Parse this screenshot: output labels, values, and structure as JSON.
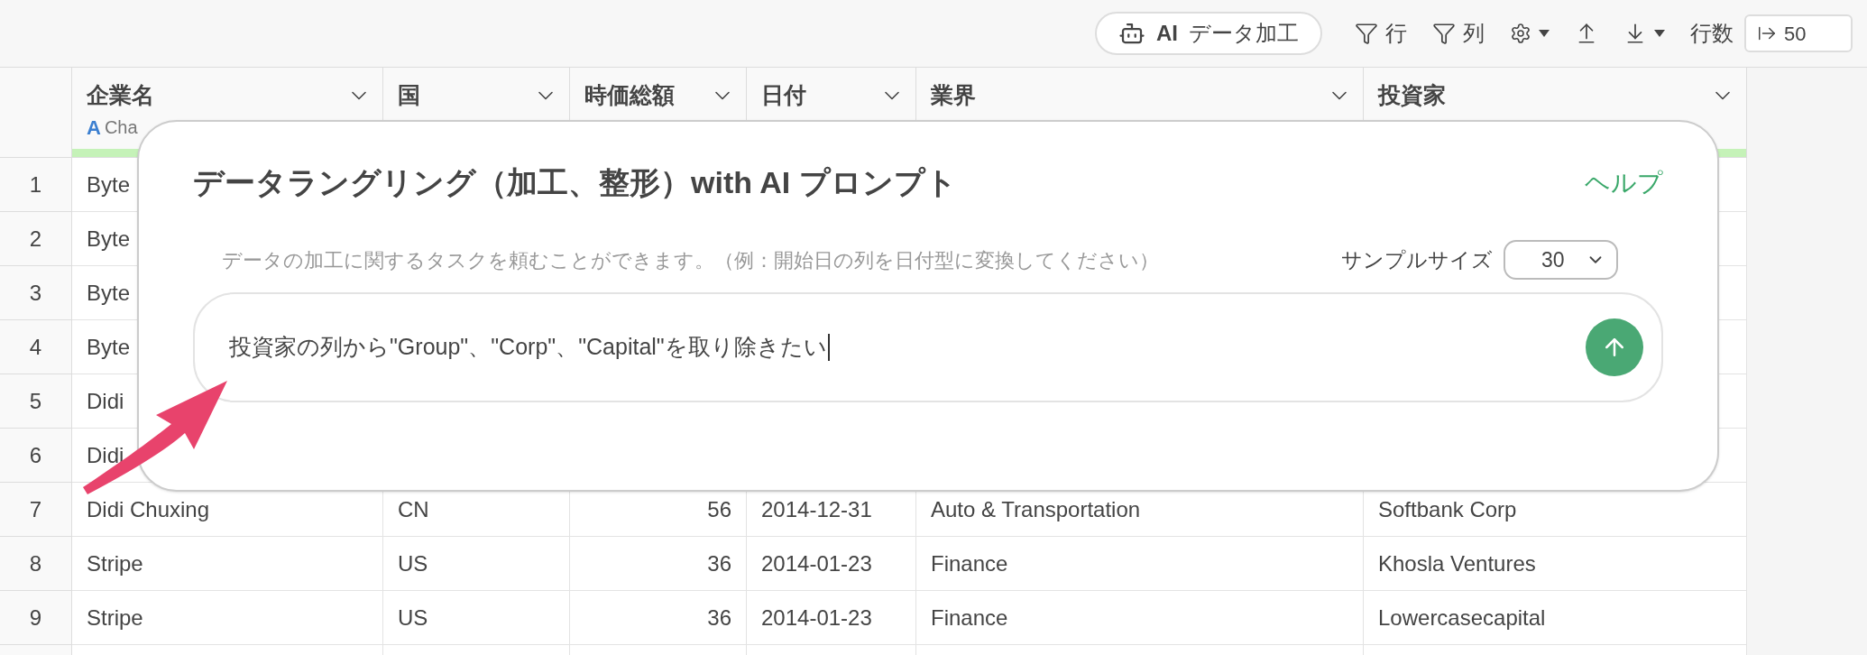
{
  "toolbar": {
    "ai_button": "AI データ加工",
    "row_filter": "行",
    "column_filter": "列",
    "row_count_label": "行数",
    "row_count_value": "50"
  },
  "table": {
    "columns": [
      {
        "label": "企業名",
        "type_icon": "A",
        "type_label": "Cha",
        "kind": "text",
        "highlighted": true
      },
      {
        "label": "国",
        "kind": "text"
      },
      {
        "label": "時価総額",
        "kind": "number"
      },
      {
        "label": "日付",
        "kind": "text"
      },
      {
        "label": "業界",
        "kind": "text"
      },
      {
        "label": "投資家",
        "kind": "text",
        "highlighted": true
      }
    ],
    "rows": [
      {
        "number": "1",
        "cells": [
          "Byte"
        ]
      },
      {
        "number": "2",
        "cells": [
          "Byte"
        ]
      },
      {
        "number": "3",
        "cells": [
          "Byte"
        ]
      },
      {
        "number": "4",
        "cells": [
          "Byte"
        ]
      },
      {
        "number": "5",
        "cells": [
          "Didi"
        ]
      },
      {
        "number": "6",
        "cells": [
          "Didi"
        ]
      },
      {
        "number": "7",
        "cells": [
          "Didi Chuxing",
          "CN",
          "56",
          "2014-12-31",
          "Auto & Transportation",
          "Softbank Corp"
        ]
      },
      {
        "number": "8",
        "cells": [
          "Stripe",
          "US",
          "36",
          "2014-01-23",
          "Finance",
          "Khosla Ventures"
        ]
      },
      {
        "number": "9",
        "cells": [
          "Stripe",
          "US",
          "36",
          "2014-01-23",
          "Finance",
          "Lowercasecapital"
        ]
      }
    ]
  },
  "dialog": {
    "title": "データラングリング（加工、整形）with AI プロンプト",
    "help_link": "ヘルプ",
    "hint": "データの加工に関するタスクを頼むことができます。（例：開始日の列を日付型に変換してください）",
    "sample_size_label": "サンプルサイズ",
    "sample_size_value": "30",
    "prompt_value": "投資家の列から\"Group\"、\"Corp\"、\"Capital\"を取り除きたい"
  }
}
